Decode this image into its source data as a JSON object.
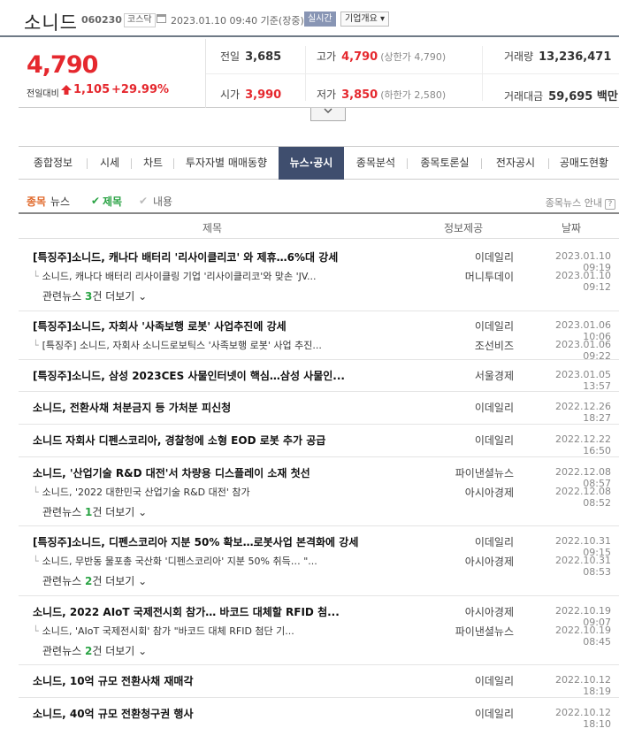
{
  "header": {
    "name": "소니드",
    "code": "060230",
    "market": "코스닥",
    "time": "2023.01.10 09:40 기준(장중)",
    "realtime": "실시간",
    "overview": "기업개요 ▾"
  },
  "quote": {
    "price": "4,790",
    "change_label": "전일대비",
    "change": "1,105",
    "rate": "+29.99%",
    "cells": {
      "prev_k": "전일",
      "prev_v": "3,685",
      "high_k": "고가",
      "high_v": "4,790",
      "high_sub": "(상한가 4,790)",
      "vol_k": "거래량",
      "vol_v": "13,236,471",
      "open_k": "시가",
      "open_v": "3,990",
      "low_k": "저가",
      "low_v": "3,850",
      "low_sub": "(하한가 2,580)",
      "amt_k": "거래대금",
      "amt_v": "59,695 백만"
    }
  },
  "tabs": [
    "종합정보",
    "시세",
    "차트",
    "투자자별 매매동향",
    "뉴스·공시",
    "종목분석",
    "종목토론실",
    "전자공시",
    "공매도현황"
  ],
  "subheader": {
    "title_a": "종목",
    "title_b": "뉴스",
    "opt1": "제목",
    "opt2": "내용",
    "guide": "종목뉴스 안내",
    "guide_icon": "?"
  },
  "table": {
    "col_title": "제목",
    "col_source": "정보제공",
    "col_date": "날짜"
  },
  "news": [
    {
      "title": "[특징주]소니드, 캐나다 배터리 '리사이클리코' 와 제휴…6%대 강세",
      "source": "이데일리",
      "date": "2023.01.10 09:19",
      "related": [
        {
          "title": "소니드, 캐나다 배터리 리사이클링 기업 '리사이클리코'와 맞손 'JV...",
          "source": "머니투데이",
          "date": "2023.01.10 09:12"
        }
      ],
      "more": {
        "pre": "관련뉴스 ",
        "n": "3",
        "post": "건 더보기 ⌄"
      }
    },
    {
      "title": "[특징주]소니드, 자회사 '사족보행 로봇' 사업추진에 강세",
      "source": "이데일리",
      "date": "2023.01.06 10:06",
      "related": [
        {
          "title": "[특징주] 소니드, 자회사 소니드로보틱스 '사족보행 로봇' 사업 추진...",
          "source": "조선비즈",
          "date": "2023.01.06 09:22"
        }
      ]
    },
    {
      "title": "[특징주]소니드, 삼성 2023CES 사물인터넷이 핵심…삼성 사물인...",
      "source": "서울경제",
      "date": "2023.01.05 13:57"
    },
    {
      "title": "소니드, 전환사채 처분금지 등 가처분 피신청",
      "source": "이데일리",
      "date": "2022.12.26 18:27"
    },
    {
      "title": "소니드 자회사 디펜스코리아, 경찰청에 소형 EOD 로봇 추가 공급",
      "source": "이데일리",
      "date": "2022.12.22 16:50"
    },
    {
      "title": "소니드, '산업기술 R&D 대전'서 차량용 디스플레이 소재 첫선",
      "source": "파이낸셜뉴스",
      "date": "2022.12.08 08:57",
      "related": [
        {
          "title": "소니드, '2022 대한민국 산업기술 R&D 대전' 참가",
          "source": "아시아경제",
          "date": "2022.12.08 08:52"
        }
      ],
      "more": {
        "pre": "관련뉴스 ",
        "n": "1",
        "post": "건 더보기 ⌄"
      }
    },
    {
      "title": "[특징주]소니드, 디펜스코리아 지분 50% 확보…로봇사업 본격화에 강세",
      "source": "이데일리",
      "date": "2022.10.31 09:15",
      "related": [
        {
          "title": "소니드, 무반동 물포총 국산화 '디펜스코리아' 지분 50% 취득… \"...",
          "source": "아시아경제",
          "date": "2022.10.31 08:53"
        }
      ],
      "more": {
        "pre": "관련뉴스 ",
        "n": "2",
        "post": "건 더보기 ⌄"
      }
    },
    {
      "title": "소니드, 2022 AIoT 국제전시회 참가… 바코드 대체할 RFID 첨...",
      "source": "아시아경제",
      "date": "2022.10.19 09:07",
      "related": [
        {
          "title": "소니드, 'AIoT 국제전시회' 참가 \"바코드 대체 RFID 첨단 기...",
          "source": "파이낸셜뉴스",
          "date": "2022.10.19 08:45"
        }
      ],
      "more": {
        "pre": "관련뉴스 ",
        "n": "2",
        "post": "건 더보기 ⌄"
      }
    },
    {
      "title": "소니드, 10억 규모 전환사채 재매각",
      "source": "이데일리",
      "date": "2022.10.12 18:19"
    },
    {
      "title": "소니드, 40억 규모 전환청구권 행사",
      "source": "이데일리",
      "date": "2022.10.12 18:10"
    }
  ]
}
